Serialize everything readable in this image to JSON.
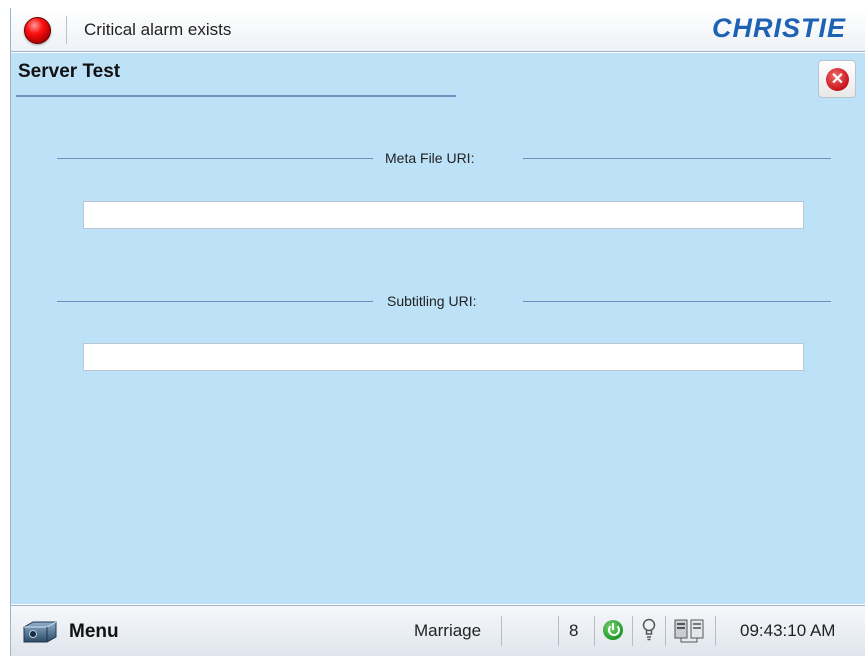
{
  "header": {
    "alarm_text": "Critical alarm exists",
    "brand": "CHRISTIE"
  },
  "page": {
    "title": "Server Test",
    "close_icon": "close-icon"
  },
  "fields": [
    {
      "label": "Meta File URI:",
      "value": ""
    },
    {
      "label": "Subtitling URI:",
      "value": ""
    }
  ],
  "footer": {
    "menu_label": "Menu",
    "mode_text": "Marriage",
    "count": "8",
    "time": "09:43:10 AM",
    "icons": [
      "projector-icon",
      "power-icon",
      "lamp-icon",
      "network-icon"
    ]
  },
  "colors": {
    "content_bg": "#bde1f7",
    "brand_blue": "#1d62b5",
    "alarm_red": "#e00000",
    "power_green": "#1f9a2b"
  }
}
